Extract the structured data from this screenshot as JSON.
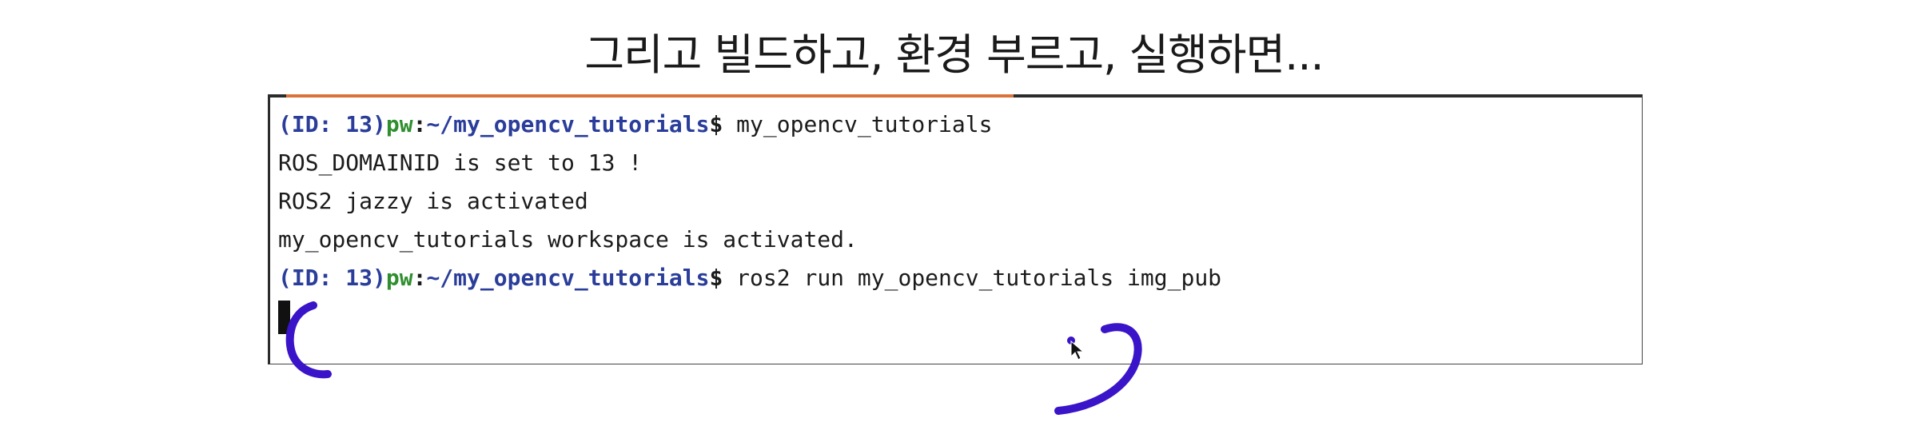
{
  "caption": "그리고 빌드하고, 환경 부르고, 실행하면...",
  "terminal": {
    "lines": [
      {
        "id": "(ID: 13)",
        "user": "pw",
        "sep": ":",
        "path": "~/my_opencv_tutorials",
        "dollar": "$",
        "cmd": " my_opencv_tutorials"
      },
      {
        "text": "ROS_DOMAINID is set to 13 !"
      },
      {
        "text": "ROS2 jazzy is activated"
      },
      {
        "text": "my_opencv_tutorials workspace is activated."
      },
      {
        "id": "(ID: 13)",
        "user": "pw",
        "sep": ":",
        "path": "~/my_opencv_tutorials",
        "dollar": "$",
        "cmd": " ros2 run my_opencv_tutorials img_pub"
      }
    ]
  },
  "colors": {
    "prompt_id": "#2a3d9a",
    "prompt_user": "#2f8f2f",
    "annotation_pen": "#3a14c8",
    "terminal_tab_accent": "#d9733a"
  },
  "icons": {
    "mouse_pointer": "arrow-cursor-icon"
  }
}
